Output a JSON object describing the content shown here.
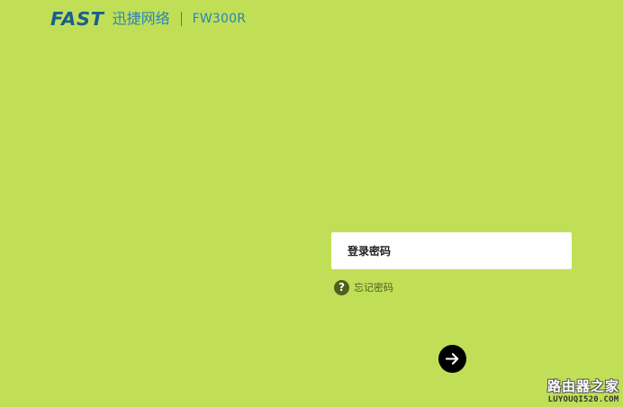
{
  "header": {
    "brand_logo": "FAST",
    "brand_cn": "迅捷网络",
    "model": "FW300R",
    "colors": {
      "logo": "#1a5e8f",
      "text": "#2a83b8"
    }
  },
  "login": {
    "password_placeholder": "登录密码",
    "password_value": "",
    "forgot_icon": "?",
    "forgot_label": "忘记密码",
    "submit_icon": "arrow-right-icon"
  },
  "watermark": {
    "cn": "路由器之家",
    "url": "LUYOUQI520.COM"
  },
  "colors": {
    "background": "#c0df57",
    "input_bg": "#ffffff",
    "forgot": "#4f5f1c",
    "button": "#000000"
  }
}
